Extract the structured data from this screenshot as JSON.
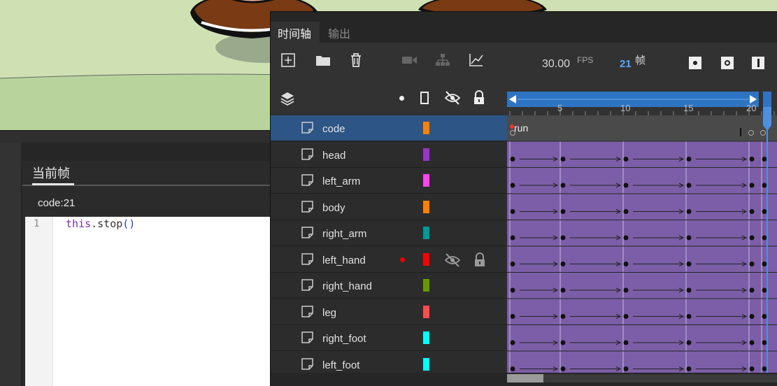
{
  "actions_panel": {
    "tab_label": "当前帧",
    "frame_label": "code:21",
    "code": {
      "line_number": "1",
      "kw": "this",
      "dot": ".",
      "fn": "stop",
      "paren": "()"
    }
  },
  "timeline": {
    "tabs": [
      {
        "label": "时间轴",
        "active": true
      },
      {
        "label": "输出",
        "active": false
      }
    ],
    "toolbar_icons": [
      "new-layer-icon",
      "folder-icon",
      "trash-icon",
      "camera-icon",
      "hierarchy-icon",
      "graph-icon"
    ],
    "fps_value": "30.00",
    "fps_unit": "FPS",
    "current_frame": "21",
    "frame_unit": "帧",
    "ruler_ticks": [
      "5",
      "10",
      "15",
      "20"
    ],
    "header_icons": [
      "layers-icon",
      "dot-icon",
      "outline-icon",
      "eye-hidden-icon",
      "lock-icon"
    ],
    "frame_label_text": "run",
    "layers": [
      {
        "name": "code",
        "color": "#ff8000",
        "selected": true
      },
      {
        "name": "head",
        "color": "#9933cc",
        "selected": false
      },
      {
        "name": "left_arm",
        "color": "#ff44ee",
        "selected": false
      },
      {
        "name": "body",
        "color": "#ff8000",
        "selected": false
      },
      {
        "name": "right_arm",
        "color": "#009999",
        "selected": false
      },
      {
        "name": "left_hand",
        "color": "#ff0000",
        "selected": false,
        "active_dot": true,
        "hidden": true,
        "locked": true
      },
      {
        "name": "right_hand",
        "color": "#669900",
        "selected": false
      },
      {
        "name": "leg",
        "color": "#ff4c4c",
        "selected": false
      },
      {
        "name": "right_foot",
        "color": "#00ffff",
        "selected": false
      },
      {
        "name": "left_foot",
        "color": "#00ffff",
        "selected": false
      }
    ],
    "colors": {
      "accent": "#2e74c4",
      "selection": "#2d5586",
      "tween": "#7b5ea7",
      "frame_number": "#5aa7ff"
    }
  }
}
